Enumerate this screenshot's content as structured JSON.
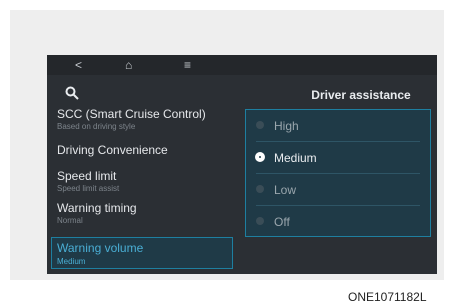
{
  "topbar": {
    "back_icon": "<",
    "home_icon": "⌂",
    "menu_icon": "≡"
  },
  "panel": {
    "title": "Driver assistance"
  },
  "menu": [
    {
      "label": "SCC (Smart Cruise Control)",
      "sub": "Based on driving style"
    },
    {
      "label": "Driving Convenience"
    },
    {
      "label": "Speed limit",
      "sub": "Speed limit assist"
    },
    {
      "label": "Warning timing",
      "sub": "Normal"
    },
    {
      "label": "Warning volume",
      "sub": "Medium",
      "selected": true
    }
  ],
  "options": [
    {
      "label": "High",
      "selected": false
    },
    {
      "label": "Medium",
      "selected": true
    },
    {
      "label": "Low",
      "selected": false
    },
    {
      "label": "Off",
      "selected": false
    }
  ],
  "caption": "ONE1071182L",
  "colors": {
    "accent": "#4aaed4",
    "screen": "#2b2f34",
    "panel": "#1f3a47"
  }
}
